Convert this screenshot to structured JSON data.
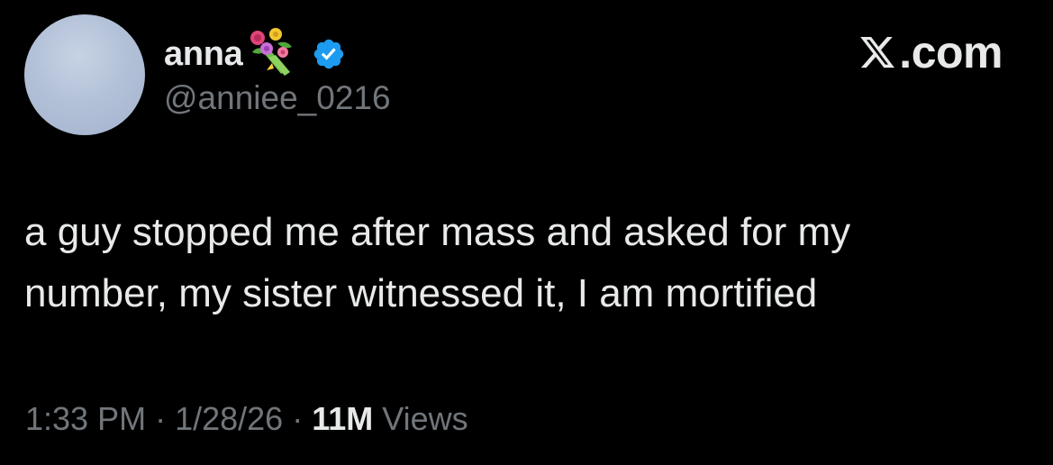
{
  "author": {
    "display_name": "anna",
    "handle": "@anniee_0216",
    "name_emoji": "bouquet-icon",
    "verified": true,
    "verified_badge_icon": "verified-badge-icon",
    "avatar_color": "#b3c1d8"
  },
  "brand": {
    "logo_icon": "x-logo-icon",
    "suffix": ".com"
  },
  "tweet": {
    "text": "a guy stopped me after mass and asked for my\nnumber, my sister witnessed it, I am mortified"
  },
  "meta": {
    "time": "1:33 PM",
    "separator": "·",
    "date": "1/28/26",
    "views_count": "11M",
    "views_label": "Views"
  },
  "colors": {
    "background": "#000000",
    "primary_text": "#e7e9ea",
    "secondary_text": "#71767b",
    "verified_blue": "#1d9bf0"
  }
}
